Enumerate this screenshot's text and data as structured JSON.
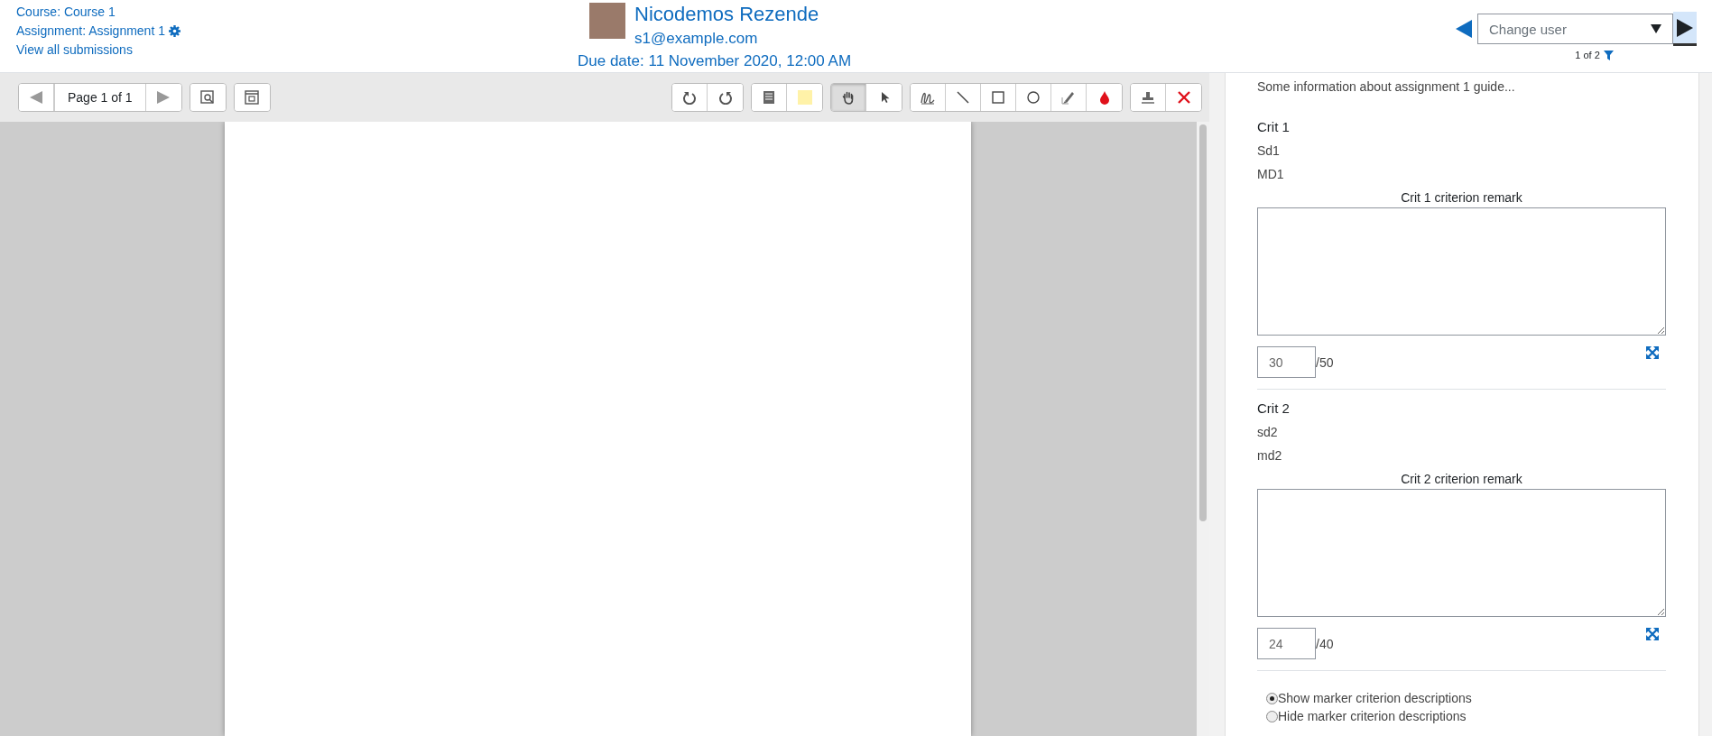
{
  "header": {
    "links": [
      "Course: Course 1",
      "Assignment: Assignment 1",
      "View all submissions"
    ],
    "user": {
      "name": "Nicodemos Rezende",
      "email": "s1@example.com",
      "due_date": "Due date: 11 November 2020, 12:00 AM"
    },
    "user_nav": {
      "placeholder": "Change user",
      "count": "1 of 2"
    }
  },
  "toolbar": {
    "page_label": "Page 1 of 1",
    "groups": [
      [
        {
          "kind": "rotate-left",
          "selected": false
        },
        {
          "kind": "rotate-right",
          "selected": false
        }
      ],
      [
        {
          "kind": "comment",
          "selected": false
        },
        {
          "kind": "swatch",
          "selected": false,
          "color": "#fff2a8"
        }
      ],
      [
        {
          "kind": "hand",
          "selected": true
        },
        {
          "kind": "pointer",
          "selected": false
        }
      ],
      [
        {
          "kind": "pen",
          "selected": false
        },
        {
          "kind": "line",
          "selected": false
        },
        {
          "kind": "rect",
          "selected": false
        },
        {
          "kind": "oval",
          "selected": false
        },
        {
          "kind": "highlight",
          "selected": false
        },
        {
          "kind": "drop",
          "selected": false,
          "color": "#e0101a"
        }
      ],
      [
        {
          "kind": "stamp",
          "selected": false
        },
        {
          "kind": "cross",
          "selected": false,
          "color": "#e0101a"
        }
      ]
    ]
  },
  "guide": {
    "intro": "Some information about assignment 1 guide...",
    "criteria": [
      {
        "name": "Crit 1",
        "description": "Sd1",
        "marker_description": "MD1",
        "remark_label": "Crit 1 criterion remark",
        "score": "30",
        "max": "/50"
      },
      {
        "name": "Crit 2",
        "description": "sd2",
        "marker_description": "md2",
        "remark_label": "Crit 2 criterion remark",
        "score": "24",
        "max": "/40"
      }
    ],
    "options": [
      {
        "label": "Show marker criterion descriptions",
        "selected": true
      },
      {
        "label": "Hide marker criterion descriptions",
        "selected": false
      }
    ]
  }
}
